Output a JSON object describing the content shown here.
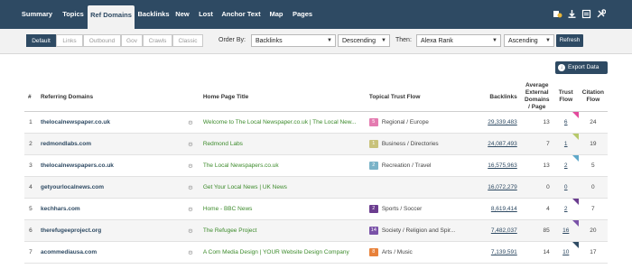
{
  "nav": {
    "tabs": [
      "Summary",
      "Topics",
      "Ref Domains",
      "Backlinks",
      "New",
      "Lost",
      "Anchor Text",
      "Map",
      "Pages"
    ],
    "active": "Ref Domains",
    "icons": [
      "history-icon",
      "download-icon",
      "report-icon",
      "tools-icon"
    ]
  },
  "filters": {
    "segments": [
      "Default",
      "Links",
      "Outbound",
      "Gov",
      "Crawls",
      "Classic"
    ],
    "active": "Default",
    "order_by_label": "Order By:",
    "order_by_value": "Backlinks",
    "order_dir_value": "Descending",
    "then_label": "Then:",
    "then_value": "Alexa Rank",
    "then_dir_value": "Ascending",
    "refresh_label": "Refresh"
  },
  "export_label": "Export Data",
  "table": {
    "headers": {
      "num": "#",
      "domain": "Referring Domains",
      "title": "Home Page Title",
      "ttf": "Topical Trust Flow",
      "backlinks": "Backlinks",
      "avg": "Average External Domains / Page",
      "tf": "Trust Flow",
      "cf": "Citation Flow"
    },
    "rows": [
      {
        "num": "1",
        "domain": "thelocalnewspaper.co.uk",
        "title": "Welcome to The Local Newspaper.co.uk | The Local New...",
        "ttf_badge": "5",
        "ttf_color": "#e47bb0",
        "ttf": "Regional / Europe",
        "backlinks": "29,339,483",
        "avg": "13",
        "tf": "6",
        "tf_tri": "#e34a9c",
        "cf": "24"
      },
      {
        "num": "2",
        "domain": "redmondlabs.com",
        "title": "Redmond Labs",
        "ttf_badge": "1",
        "ttf_color": "#c8c27a",
        "ttf": "Business / Directories",
        "backlinks": "24,087,493",
        "avg": "7",
        "tf": "1",
        "tf_tri": "#b7c96a",
        "cf": "19"
      },
      {
        "num": "3",
        "domain": "thelocalnewspapers.co.uk",
        "title": "The Local Newspapers.co.uk",
        "ttf_badge": "2",
        "ttf_color": "#7ab3c8",
        "ttf": "Recreation / Travel",
        "backlinks": "16,575,963",
        "avg": "13",
        "tf": "2",
        "tf_tri": "#5fa8c9",
        "cf": "5"
      },
      {
        "num": "4",
        "domain": "getyourlocalnews.com",
        "title": "Get Your Local News | UK News",
        "ttf_badge": "",
        "ttf_color": "",
        "ttf": "",
        "backlinks": "16,072,279",
        "avg": "0",
        "tf": "0",
        "tf_tri": "",
        "cf": "0"
      },
      {
        "num": "5",
        "domain": "kechhars.com",
        "title": "Home - BBC News",
        "ttf_badge": "2",
        "ttf_color": "#6b3d8f",
        "ttf": "Sports / Soccer",
        "backlinks": "8,619,414",
        "avg": "4",
        "tf": "2",
        "tf_tri": "#6b3d8f",
        "cf": "7"
      },
      {
        "num": "6",
        "domain": "therefugeeproject.org",
        "title": "The Refugee Project",
        "ttf_badge": "14",
        "ttf_color": "#7a52a8",
        "ttf": "Society / Religion and Spir...",
        "backlinks": "7,482,037",
        "avg": "85",
        "tf": "16",
        "tf_tri": "#7a52a8",
        "cf": "20"
      },
      {
        "num": "7",
        "domain": "acommediausa.com",
        "title": "A Com Media Design | YOUR Website Design Company",
        "ttf_badge": "8",
        "ttf_color": "#e8813a",
        "ttf": "Arts / Music",
        "backlinks": "7,139,591",
        "avg": "14",
        "tf": "10",
        "tf_tri": "#2e4a63",
        "cf": "17"
      }
    ]
  }
}
